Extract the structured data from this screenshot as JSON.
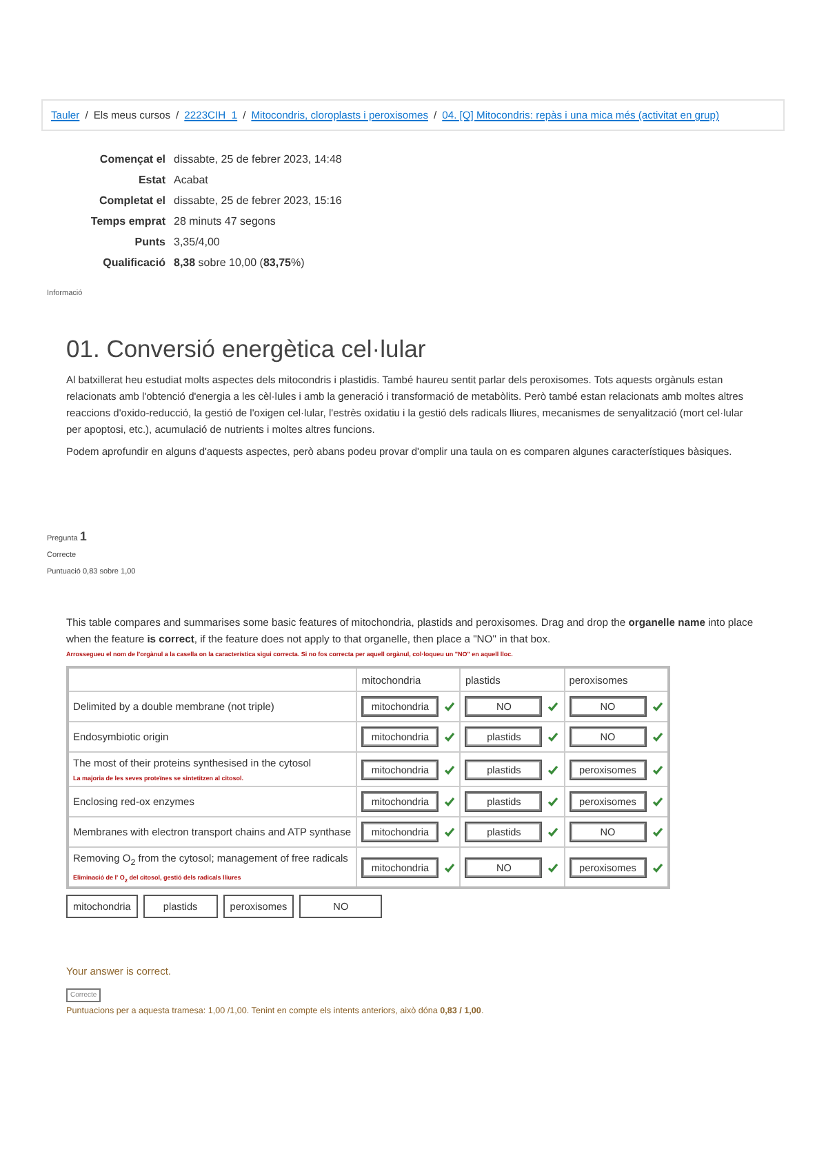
{
  "breadcrumb_separator": "/",
  "breadcrumb": [
    {
      "label": "Tauler",
      "link": true
    },
    {
      "label": "Els meus cursos",
      "link": false
    },
    {
      "label": "2223CIH_1",
      "link": true
    },
    {
      "label": "Mitocondris, cloroplasts i peroxisomes",
      "link": true
    },
    {
      "label": "04. [Q] Mitocondris: repàs i una mica més (activitat en grup)",
      "link": true
    }
  ],
  "summary": [
    {
      "label": "Començat el",
      "value": "dissabte, 25 de febrer 2023, 14:48"
    },
    {
      "label": "Estat",
      "value": "Acabat"
    },
    {
      "label": "Completat el",
      "value": "dissabte, 25 de febrer 2023, 15:16"
    },
    {
      "label": "Temps emprat",
      "value": "28 minuts 47 segons"
    },
    {
      "label": "Punts",
      "value": "3,35/4,00"
    },
    {
      "label": "Qualificació",
      "value": "**8,38** sobre 10,00 (**83,75**%)"
    }
  ],
  "info_label": "Informació",
  "section": {
    "title": "01. Conversió energètica cel·lular",
    "paragraphs": [
      "Al batxillerat heu estudiat molts aspectes dels mitocondris i plastidis. També haureu sentit parlar dels peroxisomes. Tots aquests orgànuls estan relacionats amb l'obtenció d'energia a les cèl·lules i amb la generació i transformació de metabòlits. Però també estan relacionats amb moltes altres reaccions d'oxido-reducció, la gestió de l'oxigen cel·lular, l'estrès oxidatiu i la gestió dels radicals lliures, mecanismes de senyalització (mort cel·lular per apoptosi, etc.), acumulació de nutrients i moltes altres funcions.",
      "Podem aprofundir en alguns d'aquests aspectes, però abans podeu provar d'omplir una taula on es comparen algunes característiques bàsiques."
    ]
  },
  "question": {
    "label": "Pregunta",
    "number": "1",
    "status": "Correcte",
    "score": "Puntuació 0,83 sobre 1,00",
    "prompt": "This table compares and summarises some basic features of mitochondria, plastids and peroxisomes. Drag and drop the **organelle name** into place when the feature **is correct**, if the feature does not apply to that organelle, then place a \"NO\" in that box.",
    "translation": "Arrossegueu el nom de l'orgànul a la casella on la característica sigui correcta. Si no fos correcta per aquell orgànul, col·loqueu un \"NO\" en aquell lloc.",
    "columns": [
      "mitochondria",
      "plastids",
      "peroxisomes"
    ],
    "rows": [
      {
        "feature": "Delimited by a double membrane (not triple)",
        "cells": [
          {
            "value": "mitochondria",
            "correct": true
          },
          {
            "value": "NO",
            "correct": true
          },
          {
            "value": "NO",
            "correct": true
          }
        ]
      },
      {
        "feature": "Endosymbiotic origin",
        "cells": [
          {
            "value": "mitochondria",
            "correct": true
          },
          {
            "value": "plastids",
            "correct": true
          },
          {
            "value": "NO",
            "correct": true
          }
        ]
      },
      {
        "feature": "The most of their proteins synthesised in the cytosol",
        "translation": "La majoria de les seves proteïnes se sintetitzen al citosol.",
        "cells": [
          {
            "value": "mitochondria",
            "correct": true
          },
          {
            "value": "plastids",
            "correct": true
          },
          {
            "value": "peroxisomes",
            "correct": true
          }
        ]
      },
      {
        "feature": "Enclosing red-ox enzymes",
        "cells": [
          {
            "value": "mitochondria",
            "correct": true
          },
          {
            "value": "plastids",
            "correct": true
          },
          {
            "value": "peroxisomes",
            "correct": true
          }
        ]
      },
      {
        "feature": "Membranes with electron transport chains and ATP synthase",
        "cells": [
          {
            "value": "mitochondria",
            "correct": true
          },
          {
            "value": "plastids",
            "correct": true
          },
          {
            "value": "NO",
            "correct": true
          }
        ]
      },
      {
        "feature": "Removing O$_{2}$ from the cytosol; management of free radicals",
        "translation": "Eliminació de l' O$_{2}$ del citosol, gestió dels radicals lliures",
        "cells": [
          {
            "value": "mitochondria",
            "correct": true
          },
          {
            "value": "NO",
            "correct": true
          },
          {
            "value": "peroxisomes",
            "correct": true
          }
        ]
      }
    ],
    "choices": [
      "mitochondria",
      "plastids",
      "peroxisomes",
      "NO"
    ],
    "feedback": "Your answer is correct.",
    "badge": "Correcte",
    "marks": "Puntuacions per a aquesta tramesa: 1,00 /1,00. Tenint en compte els intents anteriors, això dóna **0,83 / 1,00**."
  }
}
